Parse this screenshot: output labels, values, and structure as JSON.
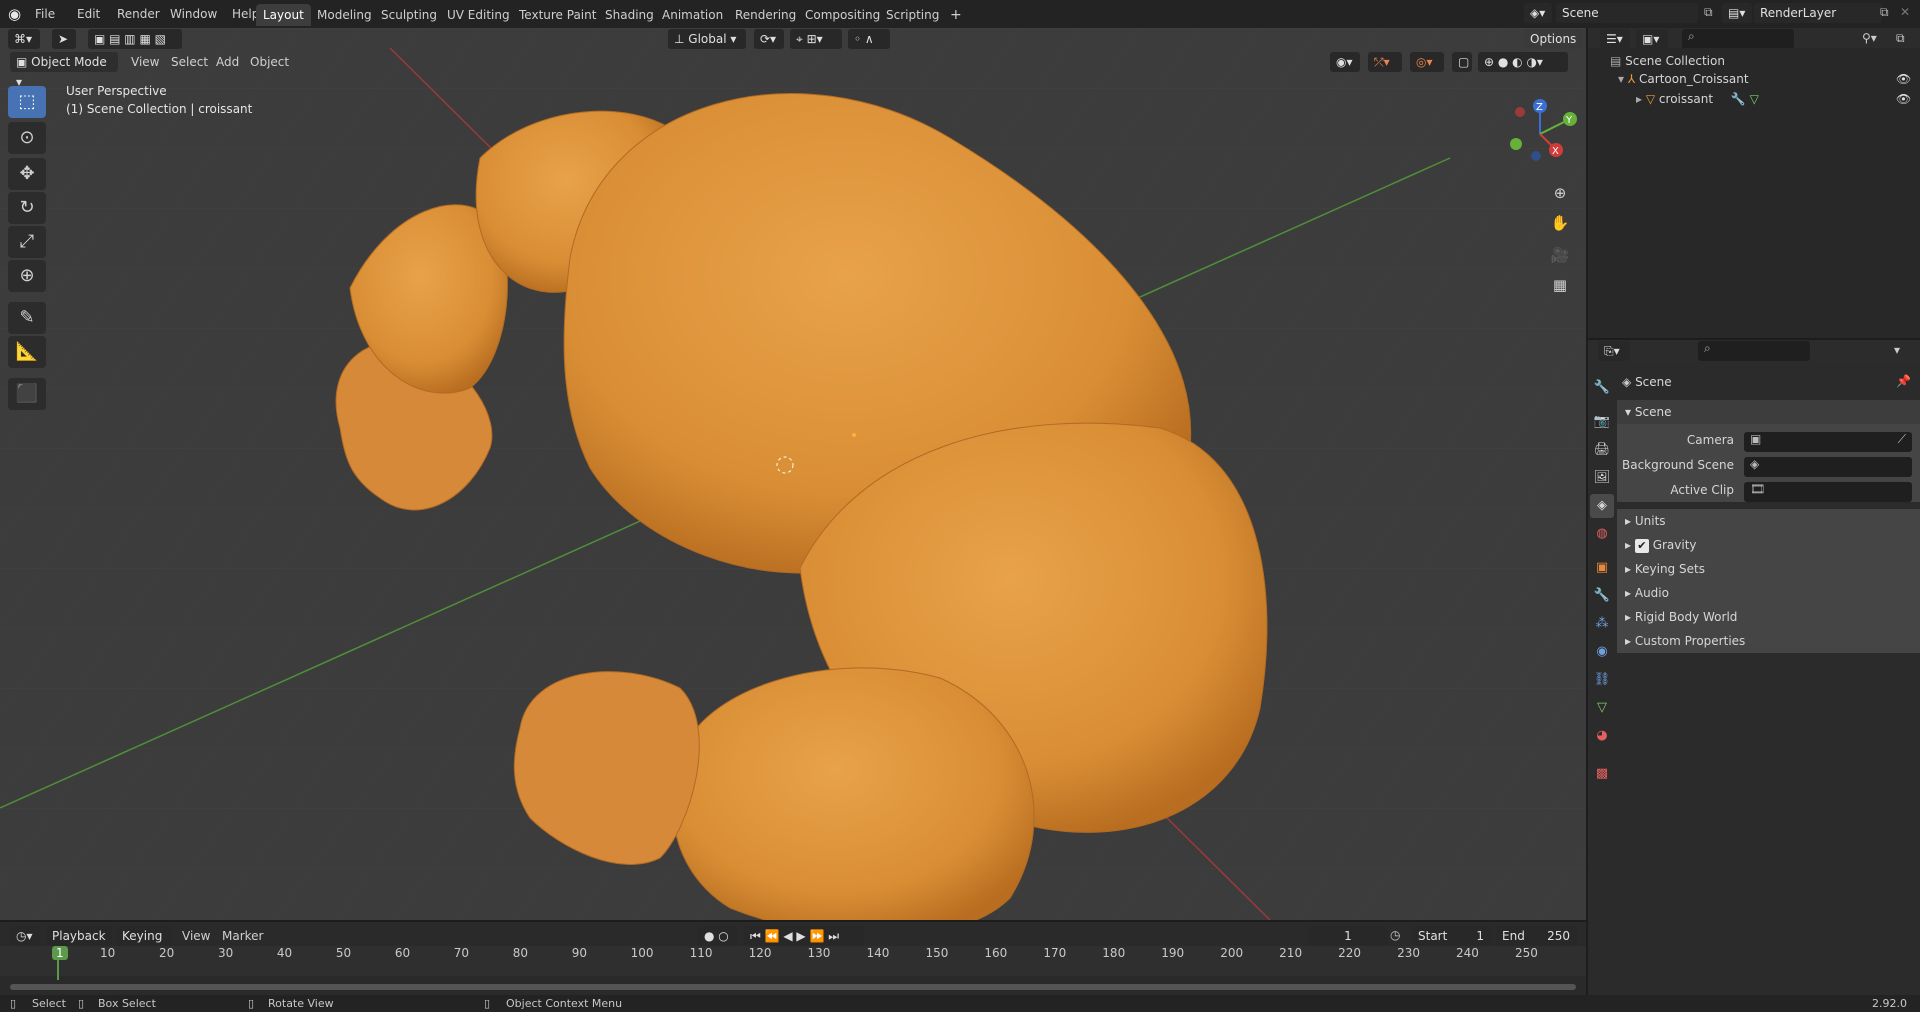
{
  "app_icon": "blender-logo-icon",
  "menus": [
    "File",
    "Edit",
    "Render",
    "Window",
    "Help"
  ],
  "workspaces": [
    "Layout",
    "Modeling",
    "Sculpting",
    "UV Editing",
    "Texture Paint",
    "Shading",
    "Animation",
    "Rendering",
    "Compositing",
    "Scripting"
  ],
  "active_workspace": "Layout",
  "scene_field": "Scene",
  "view_layer_field": "RenderLayer",
  "viewport": {
    "mode": "Object Mode",
    "menus": [
      "View",
      "Select",
      "Add",
      "Object"
    ],
    "transform_orientation": "Global",
    "options_label": "Options",
    "overlay_title": "User Perspective",
    "overlay_subtitle": "(1) Scene Collection | croissant",
    "gizmo_axes": [
      "Z",
      "Y",
      "X"
    ]
  },
  "colors": {
    "croissant": "#dd9438",
    "grid_x_axis": "#9a3a3a",
    "grid_y_axis": "#4f8f3a",
    "accent": "#4772b3",
    "viewport_bg": "#3c3c3c"
  },
  "outliner": {
    "root": "Scene Collection",
    "items": [
      {
        "label": "Cartoon_Croissant",
        "icon": "armature-icon"
      },
      {
        "label": "croissant",
        "icon": "mesh-icon"
      }
    ]
  },
  "properties": {
    "context_title": "Scene",
    "panel_title": "Scene",
    "fields": [
      {
        "label": "Camera",
        "value": ""
      },
      {
        "label": "Background Scene",
        "value": ""
      },
      {
        "label": "Active Clip",
        "value": ""
      }
    ],
    "sections": [
      "Units",
      "Gravity",
      "Keying Sets",
      "Audio",
      "Rigid Body World",
      "Custom Properties"
    ],
    "gravity_checked": true
  },
  "timeline": {
    "menus": [
      "Playback",
      "Keying",
      "View",
      "Marker"
    ],
    "current_frame": "1",
    "start_label": "Start",
    "start_value": "1",
    "end_label": "End",
    "end_value": "250",
    "ticks": [
      "1",
      "10",
      "20",
      "30",
      "40",
      "50",
      "60",
      "70",
      "80",
      "90",
      "100",
      "110",
      "120",
      "130",
      "140",
      "150",
      "160",
      "170",
      "180",
      "190",
      "200",
      "210",
      "220",
      "230",
      "240",
      "250"
    ]
  },
  "statusbar": {
    "items": [
      "Select",
      "Box Select",
      "Rotate View",
      "Object Context Menu"
    ],
    "version": "2.92.0"
  }
}
